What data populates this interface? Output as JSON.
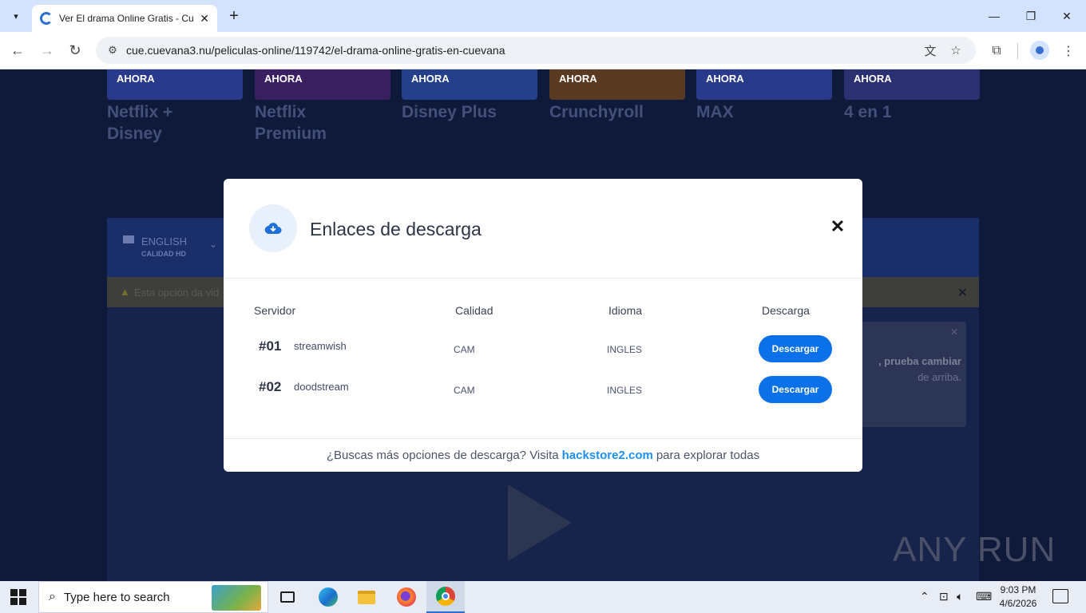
{
  "browser": {
    "tab_title": "Ver El drama Online Gratis - Cu",
    "url": "cue.cuevana3.nu/peliculas-online/119742/el-drama-online-gratis-en-cuevana"
  },
  "page": {
    "promos": [
      {
        "badge": "AHORA",
        "title": "Netflix + Disney"
      },
      {
        "badge": "AHORA",
        "title": "Netflix Premium"
      },
      {
        "badge": "AHORA",
        "title": "Disney Plus"
      },
      {
        "badge": "AHORA",
        "title": "Crunchyroll"
      },
      {
        "badge": "AHORA",
        "title": "MAX"
      },
      {
        "badge": "AHORA",
        "title": "4 en 1"
      }
    ],
    "language": {
      "name": "ENGLISH",
      "quality": "CALIDAD HD"
    },
    "warning": "Esta opción da vid",
    "tip": {
      "bold": ", prueba cambiar",
      "rest": "de arriba."
    }
  },
  "modal": {
    "title": "Enlaces de descarga",
    "headers": {
      "server": "Servidor",
      "quality": "Calidad",
      "language": "Idioma",
      "download": "Descarga"
    },
    "rows": [
      {
        "num": "#01",
        "server": "streamwish",
        "quality": "CAM",
        "language": "INGLES",
        "button": "Descargar"
      },
      {
        "num": "#02",
        "server": "doodstream",
        "quality": "CAM",
        "language": "INGLES",
        "button": "Descargar"
      }
    ],
    "footer": {
      "before": "¿Buscas más opciones de descarga? Visita",
      "link": "hackstore2.com",
      "after": "para explorar todas"
    }
  },
  "watermark": "ANY RUN",
  "taskbar": {
    "search_placeholder": "Type here to search",
    "time": "9:03 PM",
    "date": "4/6/2026"
  }
}
